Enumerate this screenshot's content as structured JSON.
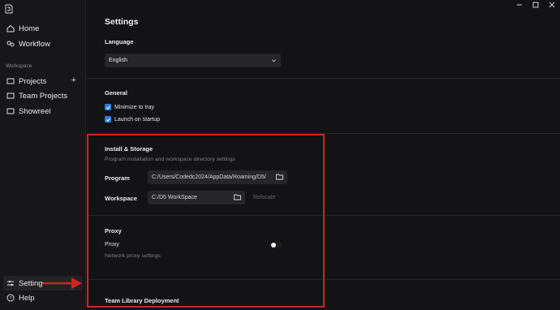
{
  "sidebar": {
    "items": [
      {
        "label": "Home",
        "icon": "home-icon"
      },
      {
        "label": "Workflow",
        "icon": "workflow-icon"
      }
    ],
    "section_label": "Workspace",
    "workspace_items": [
      {
        "label": "Projects",
        "icon": "folder-icon"
      },
      {
        "label": "Team Projects",
        "icon": "folder-icon"
      },
      {
        "label": "Showreel",
        "icon": "folder-icon"
      }
    ],
    "bottom_items": [
      {
        "label": "Setting",
        "icon": "sliders-icon"
      },
      {
        "label": "Help",
        "icon": "help-icon"
      }
    ]
  },
  "settings": {
    "title": "Settings",
    "language": {
      "heading": "Language",
      "selected": "English"
    },
    "general": {
      "heading": "General",
      "minimize_to_tray": {
        "label": "Minimize to tray",
        "checked": true
      },
      "launch_on_startup": {
        "label": "Launch on startup",
        "checked": true
      }
    },
    "install_storage": {
      "heading": "Install & Storage",
      "description": "Program installation and workspace directory settings",
      "program_label": "Program",
      "program_path": "C:/Users/Codedc2024/AppData/Roaming/D5/",
      "workspace_label": "Workspace",
      "workspace_path": "C:/D5 WorkSpace",
      "relocate_label": "Relocate"
    },
    "proxy": {
      "heading": "Proxy",
      "label": "Proxy",
      "description": "Network proxy settings",
      "enabled": false
    },
    "team_library": {
      "heading": "Team Library Deployment"
    }
  },
  "colors": {
    "accent": "#2f7de1",
    "annotation": "#d42020"
  }
}
